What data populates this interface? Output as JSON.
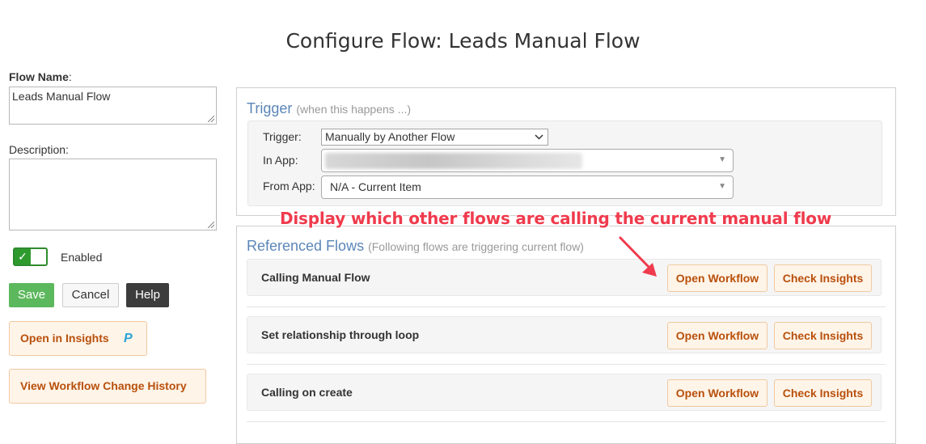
{
  "page": {
    "title": "Configure Flow: Leads Manual Flow"
  },
  "form": {
    "flow_name_label": "Flow Name",
    "flow_name_colon": ":",
    "flow_name_value": "Leads Manual Flow",
    "description_label": "Description:",
    "description_value": "",
    "enabled_label": "Enabled",
    "enabled_check": "✓"
  },
  "actions": {
    "save": "Save",
    "cancel": "Cancel",
    "help": "Help",
    "open_in_insights": "Open in Insights",
    "insights_logo": "P",
    "view_history": "View Workflow Change History"
  },
  "trigger": {
    "title": "Trigger",
    "subtitle": "(when this happens ...)",
    "trigger_label": "Trigger:",
    "trigger_value": "Manually by Another Flow",
    "in_app_label": "In App:",
    "in_app_value": "",
    "from_app_label": "From App:",
    "from_app_value": "N/A - Current Item"
  },
  "referenced": {
    "title": "Referenced Flows",
    "subtitle": "(Following flows are triggering current flow)",
    "annotation": "Display which other flows are calling the current manual flow",
    "open_workflow_label": "Open Workflow",
    "check_insights_label": "Check Insights",
    "flows": [
      {
        "name": "Calling Manual Flow"
      },
      {
        "name": "Set relationship through loop"
      },
      {
        "name": "Calling on create"
      }
    ]
  },
  "colors": {
    "accent_blue": "#5b86b8",
    "orange_text": "#b8500c",
    "orange_bg": "#fff4e8",
    "save_green": "#5cb85c",
    "annotation_red": "#ef3b4d"
  }
}
